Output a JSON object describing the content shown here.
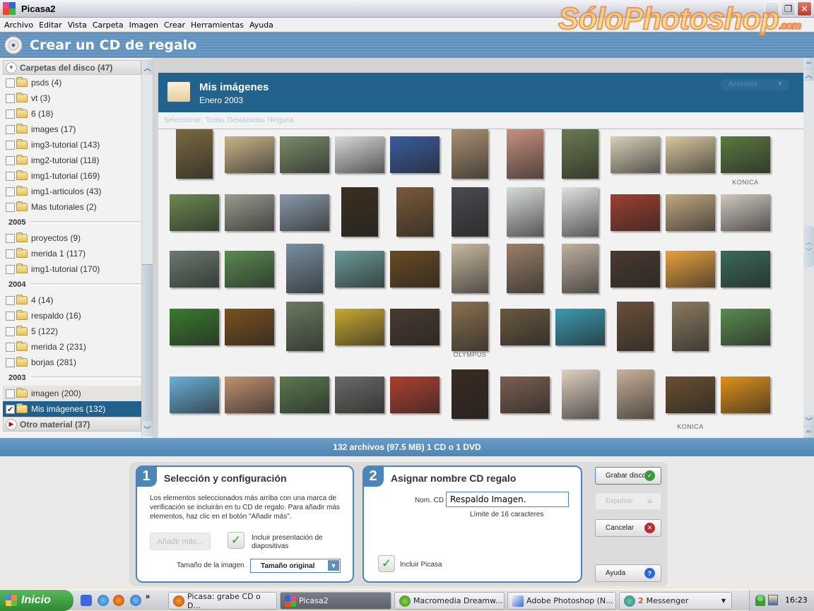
{
  "window": {
    "title": "Picasa2",
    "watermark": "SóloPhotoshop",
    "watermark_suffix": ".com",
    "controls": {
      "minimize": "_",
      "restore": "❐",
      "close": "✕"
    }
  },
  "menu": [
    "Archivo",
    "Editar",
    "Vista",
    "Carpeta",
    "Imagen",
    "Crear",
    "Herramientas",
    "Ayuda"
  ],
  "banner": {
    "title": "Crear un CD de regalo",
    "icon": "cd-icon"
  },
  "sidebar": {
    "header": "Carpetas del disco (47)",
    "groups": [
      {
        "year": "",
        "items": [
          {
            "label": "psds (4)",
            "checked": false
          },
          {
            "label": "vt (3)",
            "checked": false
          },
          {
            "label": "6 (18)",
            "checked": false
          },
          {
            "label": "images (17)",
            "checked": false
          },
          {
            "label": "img3-tutorial (143)",
            "checked": false
          },
          {
            "label": "img2-tutorial (118)",
            "checked": false
          },
          {
            "label": "img1-tutorial (169)",
            "checked": false
          },
          {
            "label": "img1-articulos (43)",
            "checked": false
          },
          {
            "label": "Mas tutoriales (2)",
            "checked": false
          }
        ]
      },
      {
        "year": "2005",
        "items": [
          {
            "label": "proyectos (9)",
            "checked": false
          },
          {
            "label": "merida 1 (117)",
            "checked": false
          },
          {
            "label": "img1-tutorial (170)",
            "checked": false
          }
        ]
      },
      {
        "year": "2004",
        "items": [
          {
            "label": "4 (14)",
            "checked": false
          },
          {
            "label": "respaldo (16)",
            "checked": false
          },
          {
            "label": "5 (122)",
            "checked": false
          },
          {
            "label": "merida 2 (231)",
            "checked": false
          },
          {
            "label": "borjas (281)",
            "checked": false
          }
        ]
      },
      {
        "year": "2003",
        "items": [
          {
            "label": "imagen (200)",
            "checked": false,
            "state": "hover"
          },
          {
            "label": "Mis imágenes (132)",
            "checked": true,
            "state": "selected"
          }
        ]
      }
    ],
    "footer": "Otro material (37)"
  },
  "gallery": {
    "folder_title": "Mis imágenes",
    "folder_date": "Enero 2003",
    "actions_label": "Acciones",
    "select_label": "Seleccionar:",
    "select_options": [
      "Todas",
      "Destacadas",
      "Ninguna"
    ],
    "camera_labels": {
      "row1": "KONICA",
      "row4": "OLYMPUS",
      "row5": "KONICA"
    },
    "thumbnail_rows": [
      [
        "#7a6a40",
        "#c8b488",
        "#7a8c6a",
        "#d8d8d8",
        "#3a5ca0",
        "#a89070",
        "#c89080",
        "#6a7a50",
        "#d8d0b8",
        "#d8c8a0",
        "#5a7a40"
      ],
      [
        "#6a8a50",
        "#9a9a90",
        "#8898a8",
        "#3a3020",
        "#7a5a38",
        "#4a4a50",
        "#d8dcd8",
        "#e0e0e0",
        "#a04030",
        "#c0a880",
        "#d0c8c0"
      ],
      [
        "#6a7a70",
        "#5a8a50",
        "#7890a0",
        "#6a9a98",
        "#6a4a20",
        "#c8b8a0",
        "#9a8068",
        "#c0b0a0",
        "#4a3a30",
        "#e8a040",
        "#3a6a58"
      ],
      [
        "#3a7a30",
        "#7a5020",
        "#6a7a60",
        "#c8a830",
        "#4a3a30",
        "#8a7050",
        "#6a5840",
        "#3a9ab0",
        "#6a5038",
        "#8a7a60",
        "#5a8a50"
      ],
      [
        "#6ab0d8",
        "#c09070",
        "#5a7a50",
        "#6a6a68",
        "#b04030",
        "#3a2a20",
        "#7a6050",
        "#e0d0c0",
        "#c8b098",
        "#6a5030",
        "#e0901a"
      ]
    ]
  },
  "status": {
    "summary": "132 archivos (97.5 MB) 1 CD o 1 DVD"
  },
  "step1": {
    "number": "1",
    "title": "Selección y configuración",
    "description": "Los elementos seleccionados más arriba con una marca de verificación se incluirán en tu CD de regalo. Para añadir más elementos, haz clic en el botón \"Añadir más\".",
    "add_more_label": "Añadir más...",
    "slideshow_label": "Incluir presentación de diapositivas",
    "slideshow_checked": true,
    "size_label": "Tamaño de la imagen",
    "size_value": "Tamaño original"
  },
  "step2": {
    "number": "2",
    "title": "Asignar nombre CD regalo",
    "name_label": "Nom. CD",
    "name_value": "Respaldo Imagen.",
    "limit_hint": "Límite de 16 caracteres",
    "include_picasa_label": "Incluir Picasa",
    "include_picasa_checked": true
  },
  "actions": {
    "burn": "Grabar disco",
    "eject": "Expulsar",
    "cancel": "Cancelar",
    "help": "Ayuda"
  },
  "taskbar": {
    "start_label": "Inicio",
    "quicklaunch_more": "»",
    "tasks": [
      {
        "label": "Picasa: grabe CD o D...",
        "active": false
      },
      {
        "label": "Picasa2",
        "active": true
      },
      {
        "label": "Macromedia Dreamw...",
        "active": false
      },
      {
        "label": "Adobe Photoshop (N...",
        "active": false
      },
      {
        "label": "Messenger",
        "count": "2",
        "active": false
      }
    ],
    "clock": "16:23"
  }
}
